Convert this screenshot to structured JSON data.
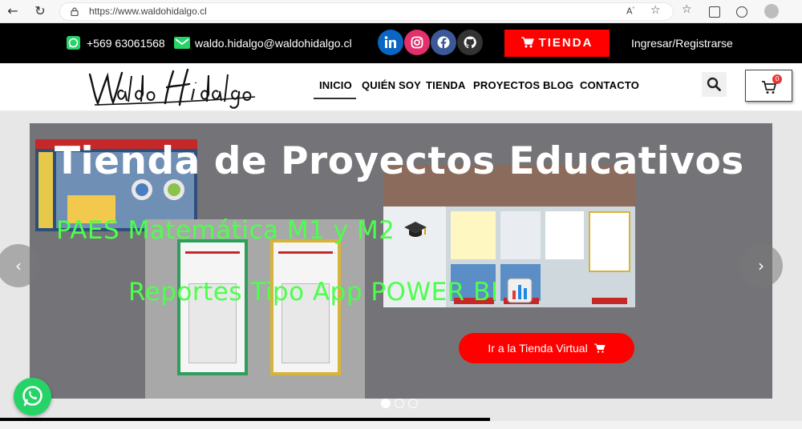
{
  "browser": {
    "url": "https://www.waldohidalgo.cl"
  },
  "topbar": {
    "phone": "+569 63061568",
    "email": "waldo.hidalgo@waldohidalgo.cl",
    "store_button": "TIENDA",
    "login": "Ingresar/Registrarse",
    "social_colors": {
      "linkedin": "#0a66c2",
      "instagram": "#e1306c",
      "facebook": "#3b5998",
      "github": "#333333"
    }
  },
  "nav": {
    "logo_text": "Waldo Hidalgo",
    "items": [
      "INICIO",
      "QUIÉN SOY",
      "TIENDA",
      "PROYECTOS",
      "BLOG",
      "CONTACTO"
    ],
    "cart_count": "0"
  },
  "hero": {
    "title": "Tienda de Proyectos Educativos",
    "subtitle1": "PAES Matemática M1 y M2",
    "subtitle2": "Reportes Tipo App POWER BI",
    "cta": "Ir a la Tienda Virtual",
    "prev": "‹",
    "next": "›",
    "slides_total": 3,
    "active_slide": 1
  },
  "colors": {
    "accent_red": "#ff0000",
    "green_text": "#4cff4c",
    "whatsapp": "#25d366"
  }
}
